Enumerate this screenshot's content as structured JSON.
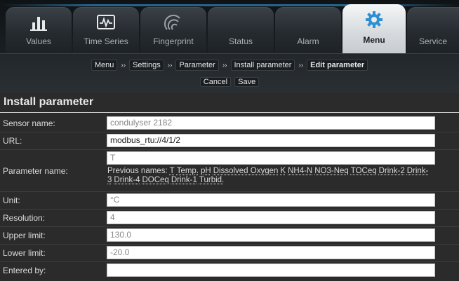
{
  "tabs": [
    {
      "label": "Values",
      "icon": "bar-chart-icon"
    },
    {
      "label": "Time Series",
      "icon": "waveform-icon"
    },
    {
      "label": "Fingerprint",
      "icon": "fingerprint-icon"
    },
    {
      "label": "Status",
      "icon": ""
    },
    {
      "label": "Alarm",
      "icon": ""
    },
    {
      "label": "Menu",
      "icon": "gear-icon",
      "active": true
    },
    {
      "label": "Service",
      "icon": ""
    }
  ],
  "breadcrumb": [
    "Menu",
    "Settings",
    "Parameter",
    "Install parameter",
    "Edit parameter"
  ],
  "breadcrumb_separator": "››",
  "actions": {
    "cancel": "Cancel",
    "save": "Save"
  },
  "section_title": "Install parameter",
  "form": {
    "sensor_name": {
      "label": "Sensor name:",
      "value": "condulyser 2182"
    },
    "url": {
      "label": "URL:",
      "value": "modbus_rtu://4/1/2"
    },
    "parameter_name": {
      "label": "Parameter name:",
      "value": "T",
      "previous_prefix": "Previous names:",
      "previous_names": [
        "T",
        "Temp.",
        "pH",
        "Dissolved Oxygen",
        "K",
        "NH4-N",
        "NO3-Neq",
        "TOCeq",
        "Drink-2",
        "Drink-3",
        "Drink-4",
        "DOCeq",
        "Drink-1",
        "Turbid."
      ]
    },
    "unit": {
      "label": "Unit:",
      "value": "°C"
    },
    "resolution": {
      "label": "Resolution:",
      "value": "4"
    },
    "upper_limit": {
      "label": "Upper limit:",
      "value": "130.0"
    },
    "lower_limit": {
      "label": "Lower limit:",
      "value": "-20.0"
    },
    "entered_by": {
      "label": "Entered by:",
      "value": ""
    }
  },
  "colors": {
    "accent": "#3aa6e8",
    "background": "#2b2b2b",
    "field_bg": "#ffffff"
  }
}
